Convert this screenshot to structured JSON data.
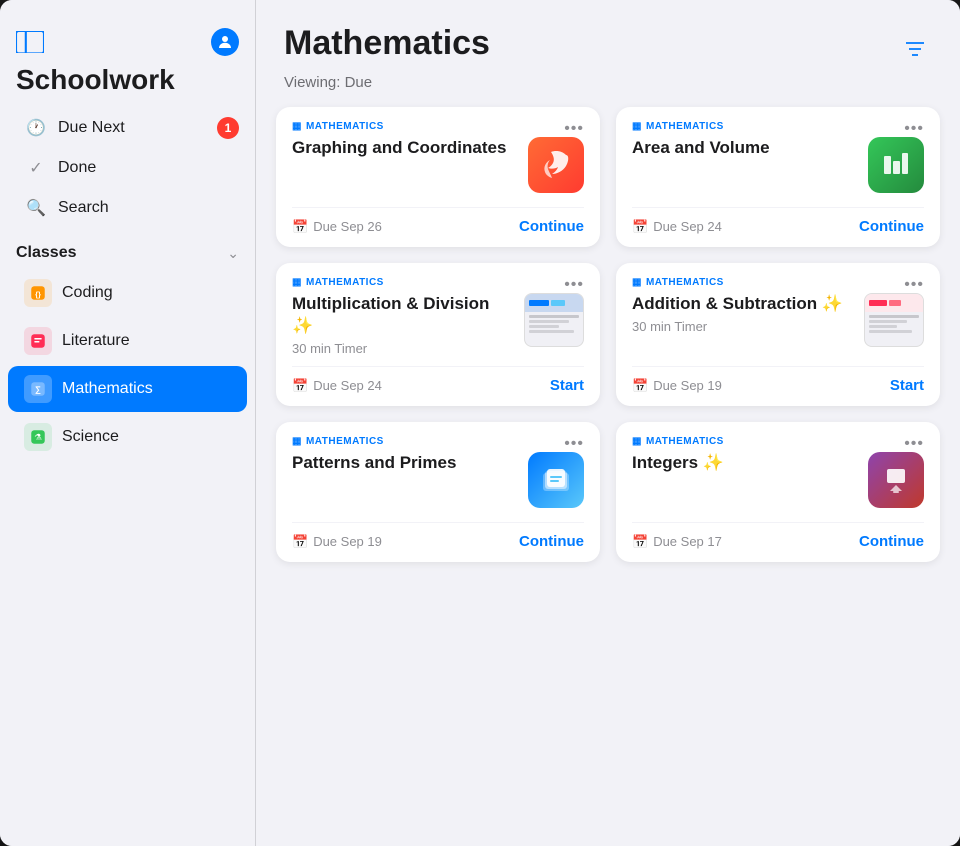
{
  "app": {
    "title": "Schoolwork"
  },
  "sidebar": {
    "toggle_label": "Toggle Sidebar",
    "user_label": "User Profile",
    "title": "Schoolwork",
    "nav_items": [
      {
        "id": "due-next",
        "label": "Due Next",
        "icon": "clock",
        "badge": "1"
      },
      {
        "id": "done",
        "label": "Done",
        "icon": "checkmark",
        "badge": null
      },
      {
        "id": "search",
        "label": "Search",
        "icon": "search",
        "badge": null
      }
    ],
    "classes_section": {
      "label": "Classes",
      "chevron": "chevron-down",
      "items": [
        {
          "id": "coding",
          "label": "Coding",
          "icon": "🧡",
          "color": "#ff9500",
          "active": false
        },
        {
          "id": "literature",
          "label": "Literature",
          "icon": "📊",
          "color": "#ff2d55",
          "active": false
        },
        {
          "id": "mathematics",
          "label": "Mathematics",
          "icon": "📋",
          "color": "#007aff",
          "active": true
        },
        {
          "id": "science",
          "label": "Science",
          "icon": "🔬",
          "color": "#34c759",
          "active": false
        }
      ]
    }
  },
  "main": {
    "title": "Mathematics",
    "viewing_label": "Viewing: Due",
    "filter_icon": "filter",
    "cards": [
      {
        "id": "graphing",
        "subject": "MATHEMATICS",
        "title": "Graphing and Coordinates",
        "subtitle": "",
        "app_icon": "swift",
        "due": "Due Sep 26",
        "action": "Continue",
        "action_type": "continue"
      },
      {
        "id": "area-volume",
        "subject": "MATHEMATICS",
        "title": "Area and Volume",
        "subtitle": "",
        "app_icon": "numbers",
        "due": "Due Sep 24",
        "action": "Continue",
        "action_type": "continue"
      },
      {
        "id": "multiplication",
        "subject": "MATHEMATICS",
        "title": "Multiplication & Division ✨",
        "subtitle": "30 min Timer",
        "app_icon": "thumbnail-multi",
        "due": "Due Sep 24",
        "action": "Start",
        "action_type": "start"
      },
      {
        "id": "addition",
        "subject": "MATHEMATICS",
        "title": "Addition & Subtraction ✨",
        "subtitle": "30 min Timer",
        "app_icon": "thumbnail-add",
        "due": "Due Sep 19",
        "action": "Start",
        "action_type": "start"
      },
      {
        "id": "patterns",
        "subject": "MATHEMATICS",
        "title": "Patterns and Primes",
        "subtitle": "",
        "app_icon": "files",
        "due": "Due Sep 19",
        "action": "Continue",
        "action_type": "continue"
      },
      {
        "id": "integers",
        "subject": "MATHEMATICS",
        "title": "Integers ✨",
        "subtitle": "",
        "app_icon": "keynote",
        "due": "Due Sep 17",
        "action": "Continue",
        "action_type": "continue"
      }
    ]
  }
}
